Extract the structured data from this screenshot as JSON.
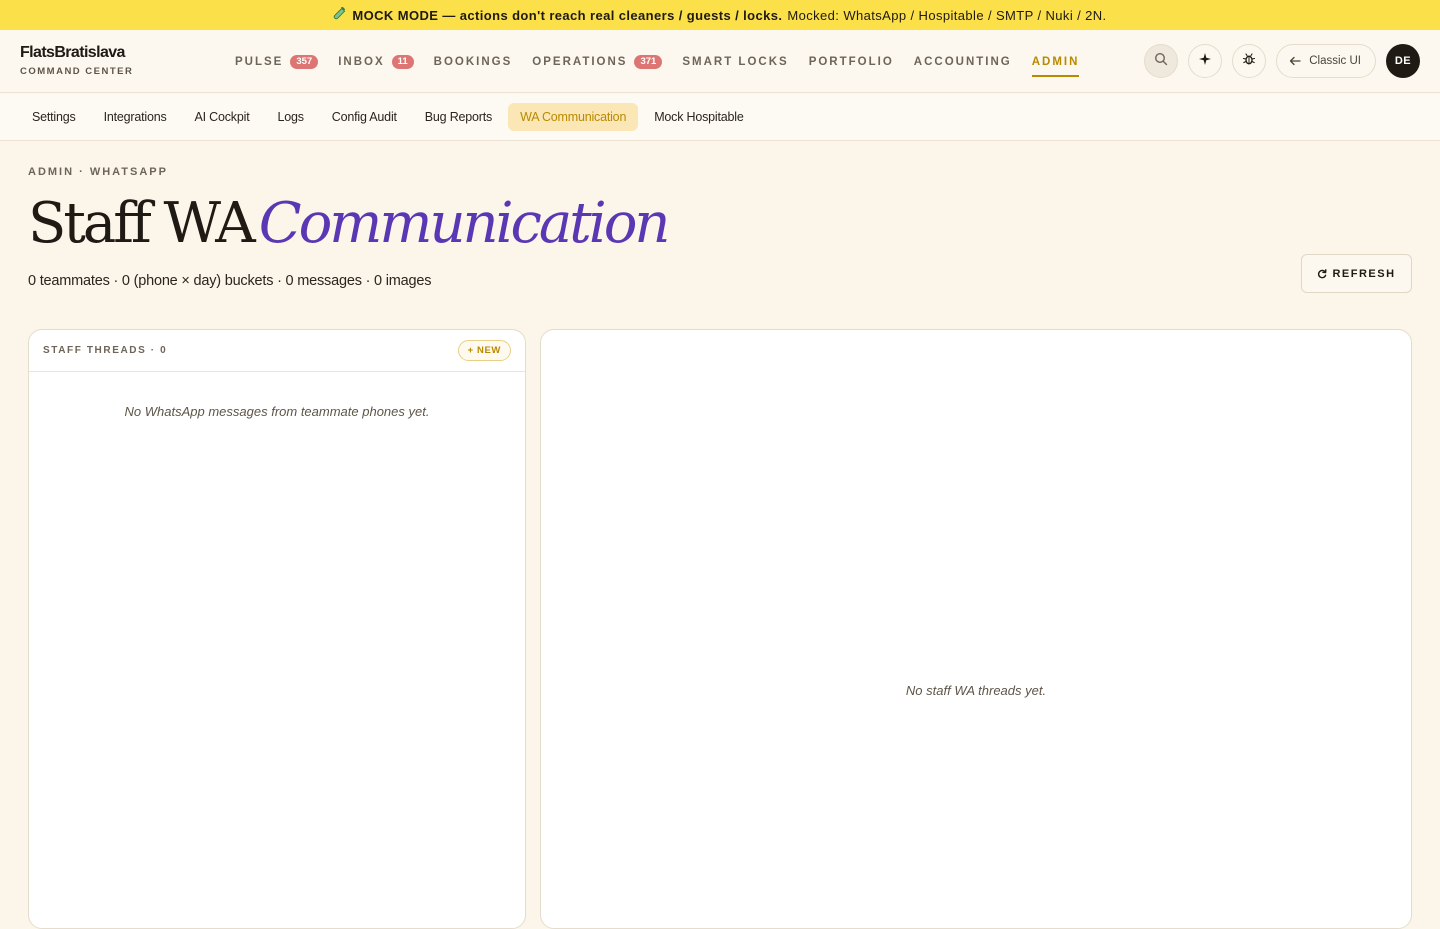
{
  "banner": {
    "icon": "flask-icon",
    "strong": "MOCK MODE — actions don't reach real cleaners / guests / locks.",
    "detail": "Mocked: WhatsApp / Hospitable / SMTP / Nuki / 2N."
  },
  "brand": {
    "name": "FlatsBratislava",
    "subtitle": "COMMAND CENTER"
  },
  "nav": {
    "items": [
      {
        "label": "PULSE",
        "badge": "357"
      },
      {
        "label": "INBOX",
        "badge": "11"
      },
      {
        "label": "BOOKINGS"
      },
      {
        "label": "OPERATIONS",
        "badge": "371"
      },
      {
        "label": "SMART LOCKS"
      },
      {
        "label": "PORTFOLIO"
      },
      {
        "label": "ACCOUNTING"
      },
      {
        "label": "ADMIN",
        "active": true
      }
    ],
    "accent_color": "#b88a00",
    "badge_color": "#dd7573"
  },
  "header_actions": {
    "icons": [
      "search-icon",
      "sparkle-icon",
      "bug-icon"
    ],
    "classic_label": "Classic UI",
    "avatar_initials": "DE"
  },
  "sub_nav": {
    "items": [
      {
        "label": "Settings"
      },
      {
        "label": "Integrations"
      },
      {
        "label": "AI Cockpit"
      },
      {
        "label": "Logs"
      },
      {
        "label": "Config Audit"
      },
      {
        "label": "Bug Reports"
      },
      {
        "label": "WA Communication",
        "active": true
      },
      {
        "label": "Mock Hospitable"
      }
    ]
  },
  "page": {
    "eyebrow": "ADMIN · WHATSAPP",
    "title_plain": "Staff WA",
    "title_accent": "Communication",
    "title_accent_color": "#5a37b3",
    "stats": "0 teammates · 0 (phone × day) buckets · 0 messages · 0 images",
    "refresh_label": "REFRESH"
  },
  "threads": {
    "title": "STAFF THREADS · 0",
    "new_label": "+ NEW",
    "empty_text": "No WhatsApp messages from teammate phones yet."
  },
  "detail": {
    "empty_text": "No staff WA threads yet."
  }
}
